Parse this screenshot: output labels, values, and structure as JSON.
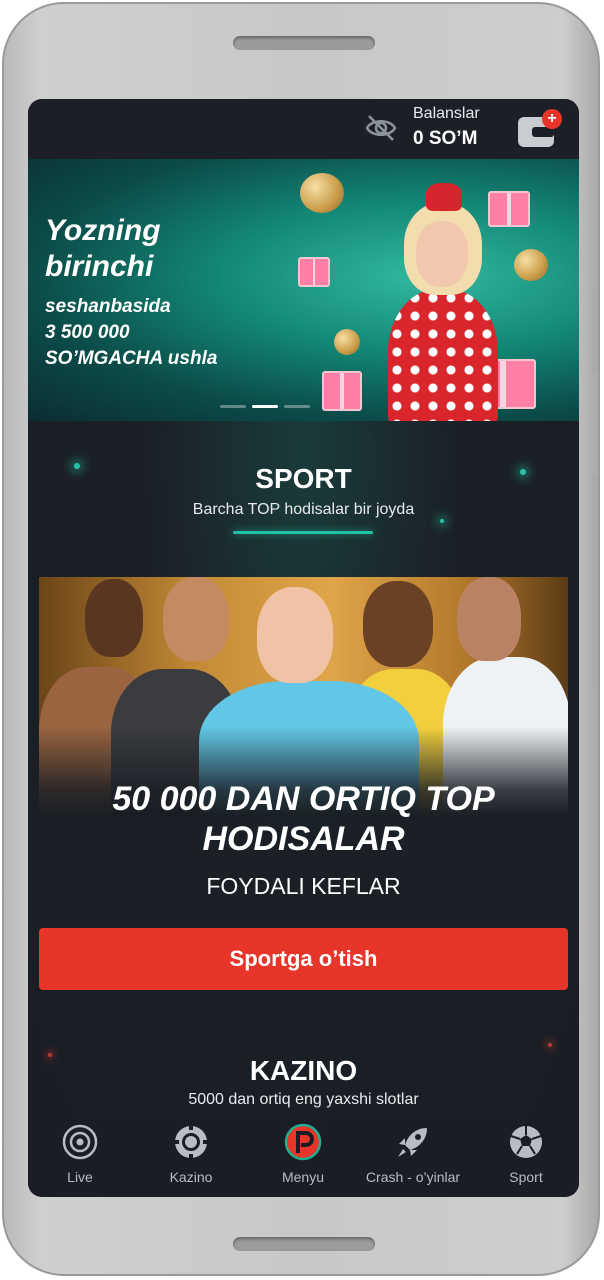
{
  "header": {
    "balance_label": "Balanslar",
    "balance_value": "0 SO’M",
    "hide_balance_icon": "eye-off-icon",
    "wallet_icon": "wallet-icon",
    "wallet_badge": "+"
  },
  "banner": {
    "title": "Yozning birinchi",
    "subtitle_line1": "seshanbasida",
    "subtitle_line2": "3 500 000",
    "subtitle_line3": "SO’MGACHA ushla"
  },
  "sport": {
    "title": "SPORT",
    "subtitle": "Barcha TOP hodisalar bir joyda",
    "headline_line1": "50 000 DAN ORTIQ TOP",
    "headline_line2": "HODISALAR",
    "odds_text": "FOYDALI KEFLAR",
    "cta_label": "Sportga o’tish"
  },
  "kazino": {
    "title": "KAZINO",
    "subtitle": "5000 dan ortiq eng yaxshi slotlar"
  },
  "nav": {
    "items": [
      {
        "label": "Live",
        "icon": "live-icon"
      },
      {
        "label": "Kazino",
        "icon": "chip-icon"
      },
      {
        "label": "Menyu",
        "icon": "menu-logo-icon"
      },
      {
        "label": "Crash - o’yinlar",
        "icon": "rocket-icon"
      },
      {
        "label": "Sport",
        "icon": "soccer-ball-icon"
      }
    ]
  },
  "colors": {
    "accent_red": "#e8352a",
    "accent_teal": "#22c3a5",
    "background": "#1a1e24"
  }
}
